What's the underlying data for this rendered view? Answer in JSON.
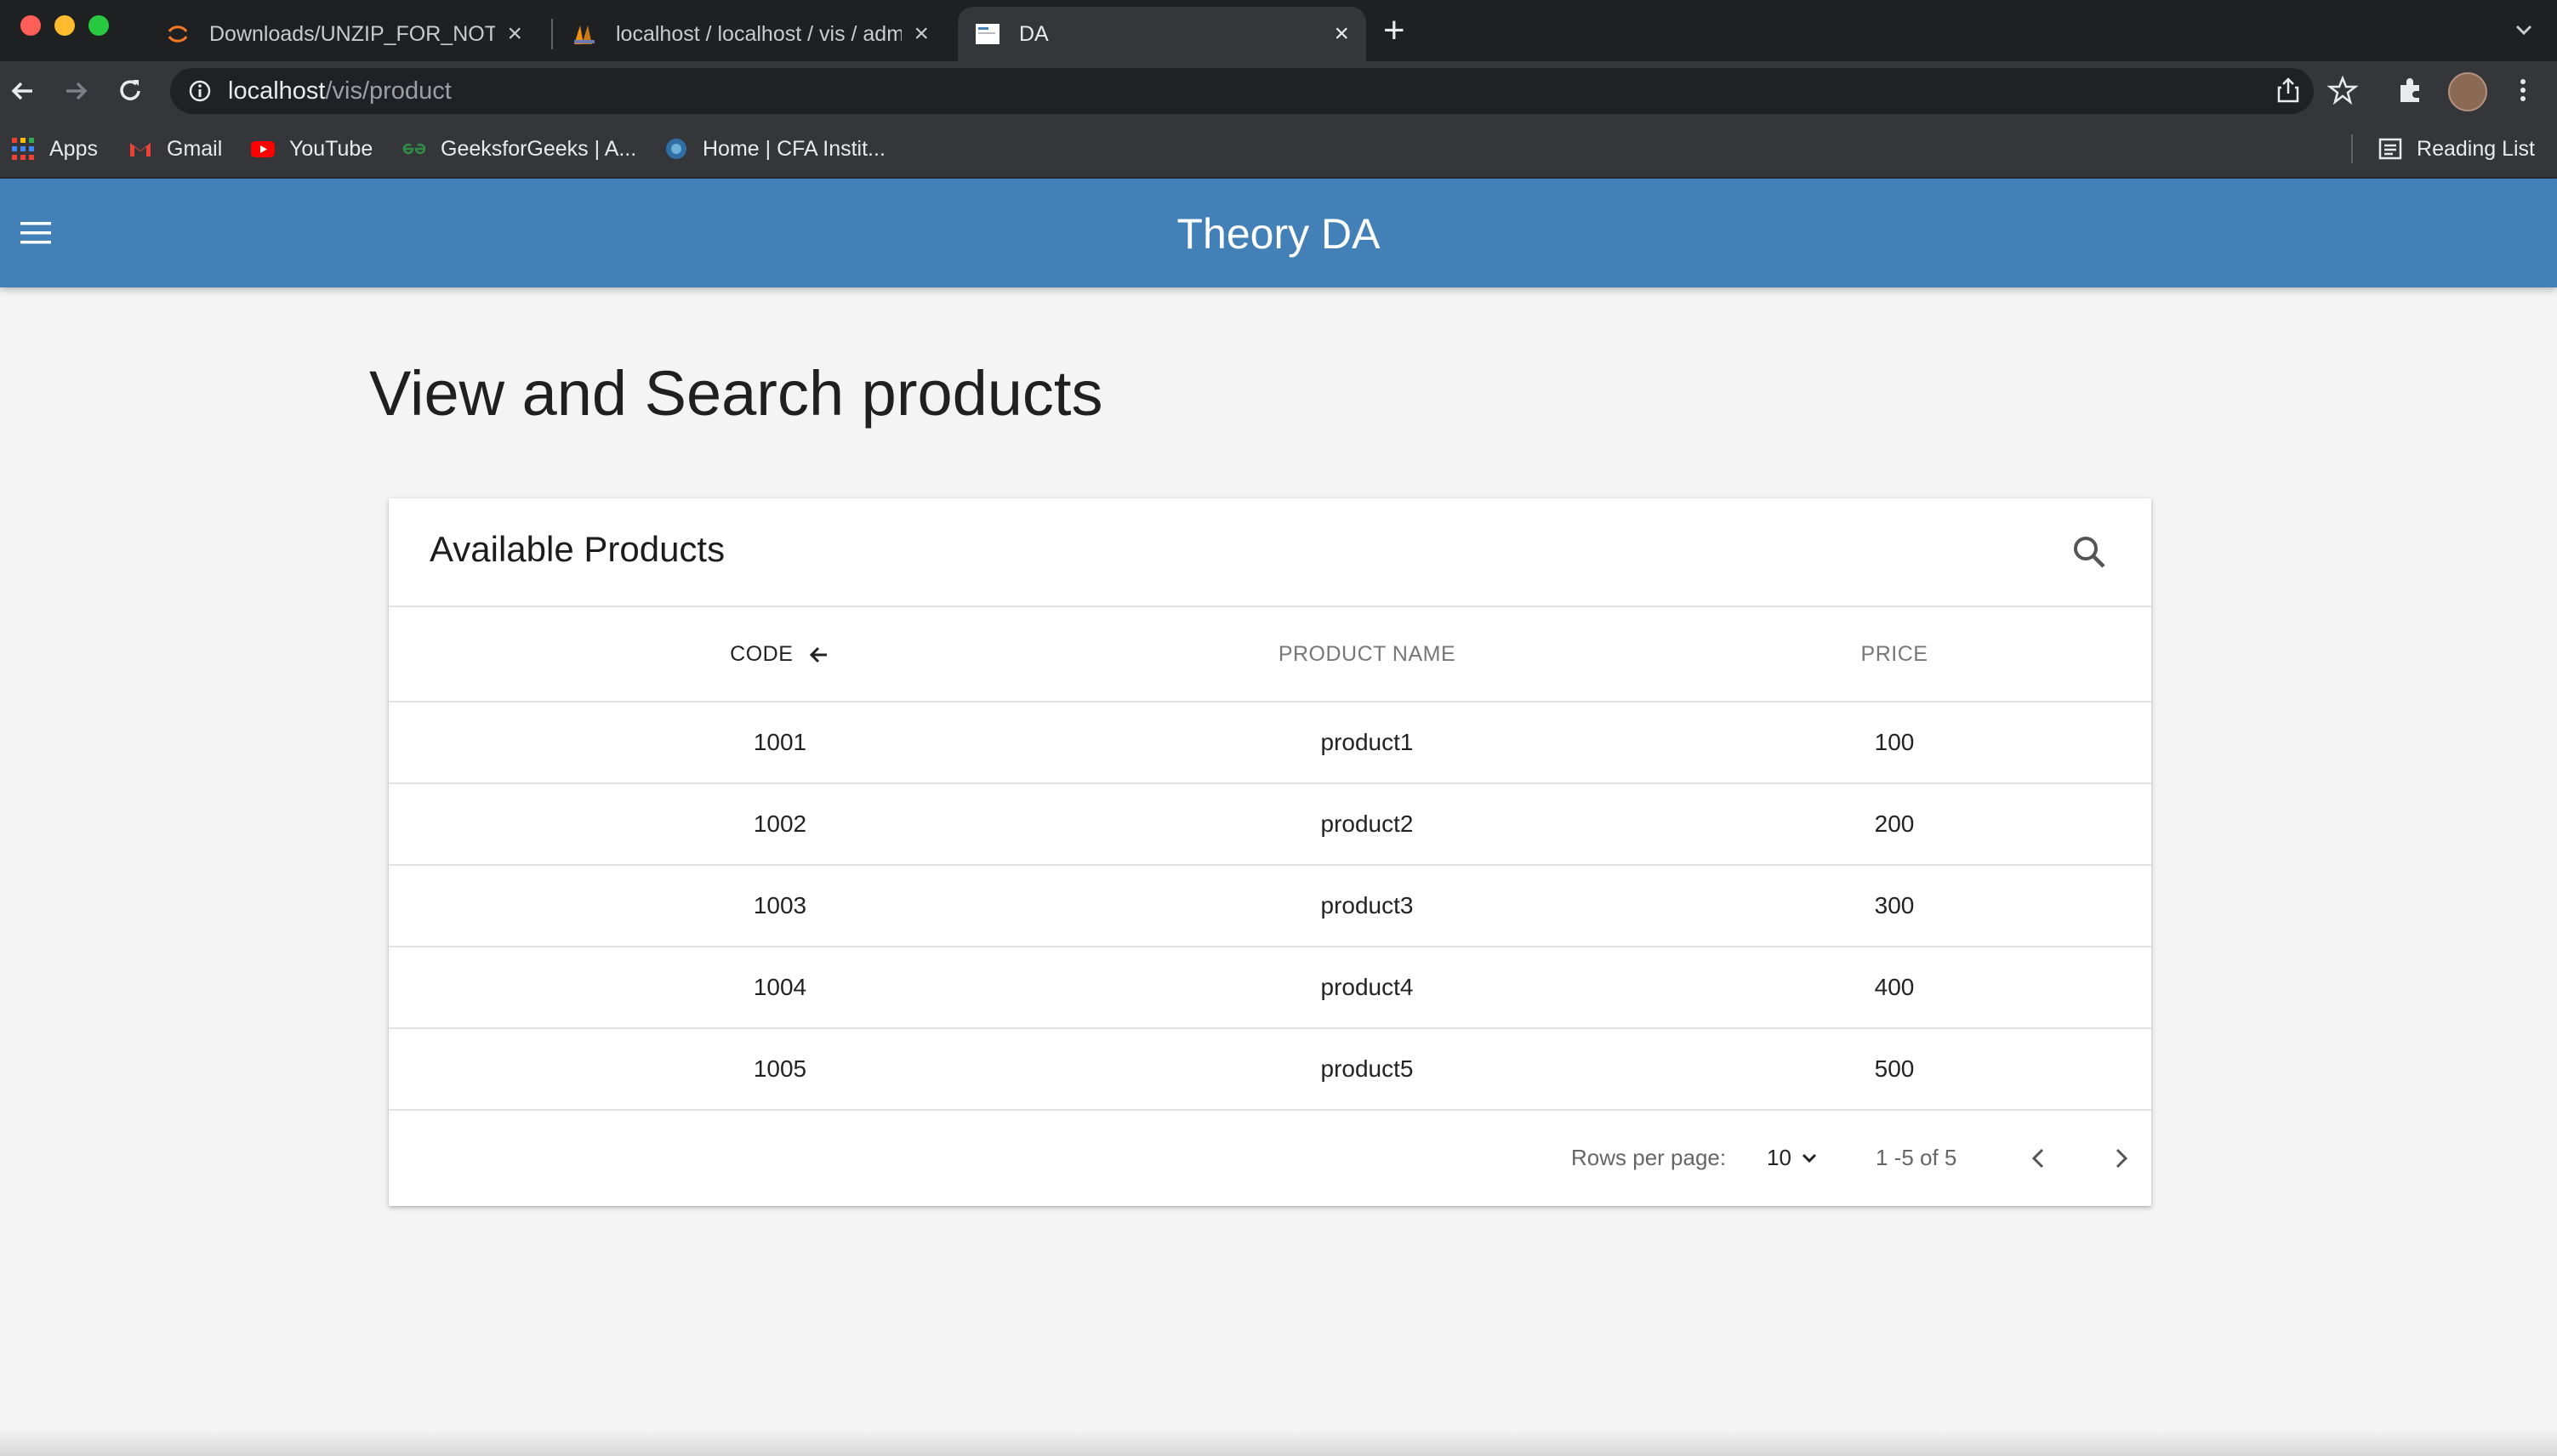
{
  "browser": {
    "tabs": [
      {
        "title": "Downloads/UNZIP_FOR_NOTE",
        "active": false
      },
      {
        "title": "localhost / localhost / vis / adm",
        "active": false
      },
      {
        "title": "DA",
        "active": true
      }
    ],
    "url_host": "localhost",
    "url_path": "/vis/product",
    "bookmarks": [
      {
        "label": "Apps",
        "icon": "apps-grid-icon"
      },
      {
        "label": "Gmail",
        "icon": "gmail-icon"
      },
      {
        "label": "YouTube",
        "icon": "youtube-icon"
      },
      {
        "label": "GeeksforGeeks | A...",
        "icon": "geeksforgeeks-icon"
      },
      {
        "label": "Home | CFA Instit...",
        "icon": "cfa-icon"
      }
    ],
    "reading_list": "Reading List"
  },
  "app": {
    "title": "Theory DA",
    "accent": "#4380b8"
  },
  "page": {
    "title": "View and Search products"
  },
  "table": {
    "title": "Available Products",
    "columns": [
      "CODE",
      "PRODUCT NAME",
      "PRICE"
    ],
    "sort_column": "CODE",
    "rows": [
      [
        "1001",
        "product1",
        "100"
      ],
      [
        "1002",
        "product2",
        "200"
      ],
      [
        "1003",
        "product3",
        "300"
      ],
      [
        "1004",
        "product4",
        "400"
      ],
      [
        "1005",
        "product5",
        "500"
      ]
    ],
    "footer": {
      "rows_per_page_label": "Rows per page:",
      "rows_per_page": "10",
      "range": "1 -5 of 5"
    }
  }
}
